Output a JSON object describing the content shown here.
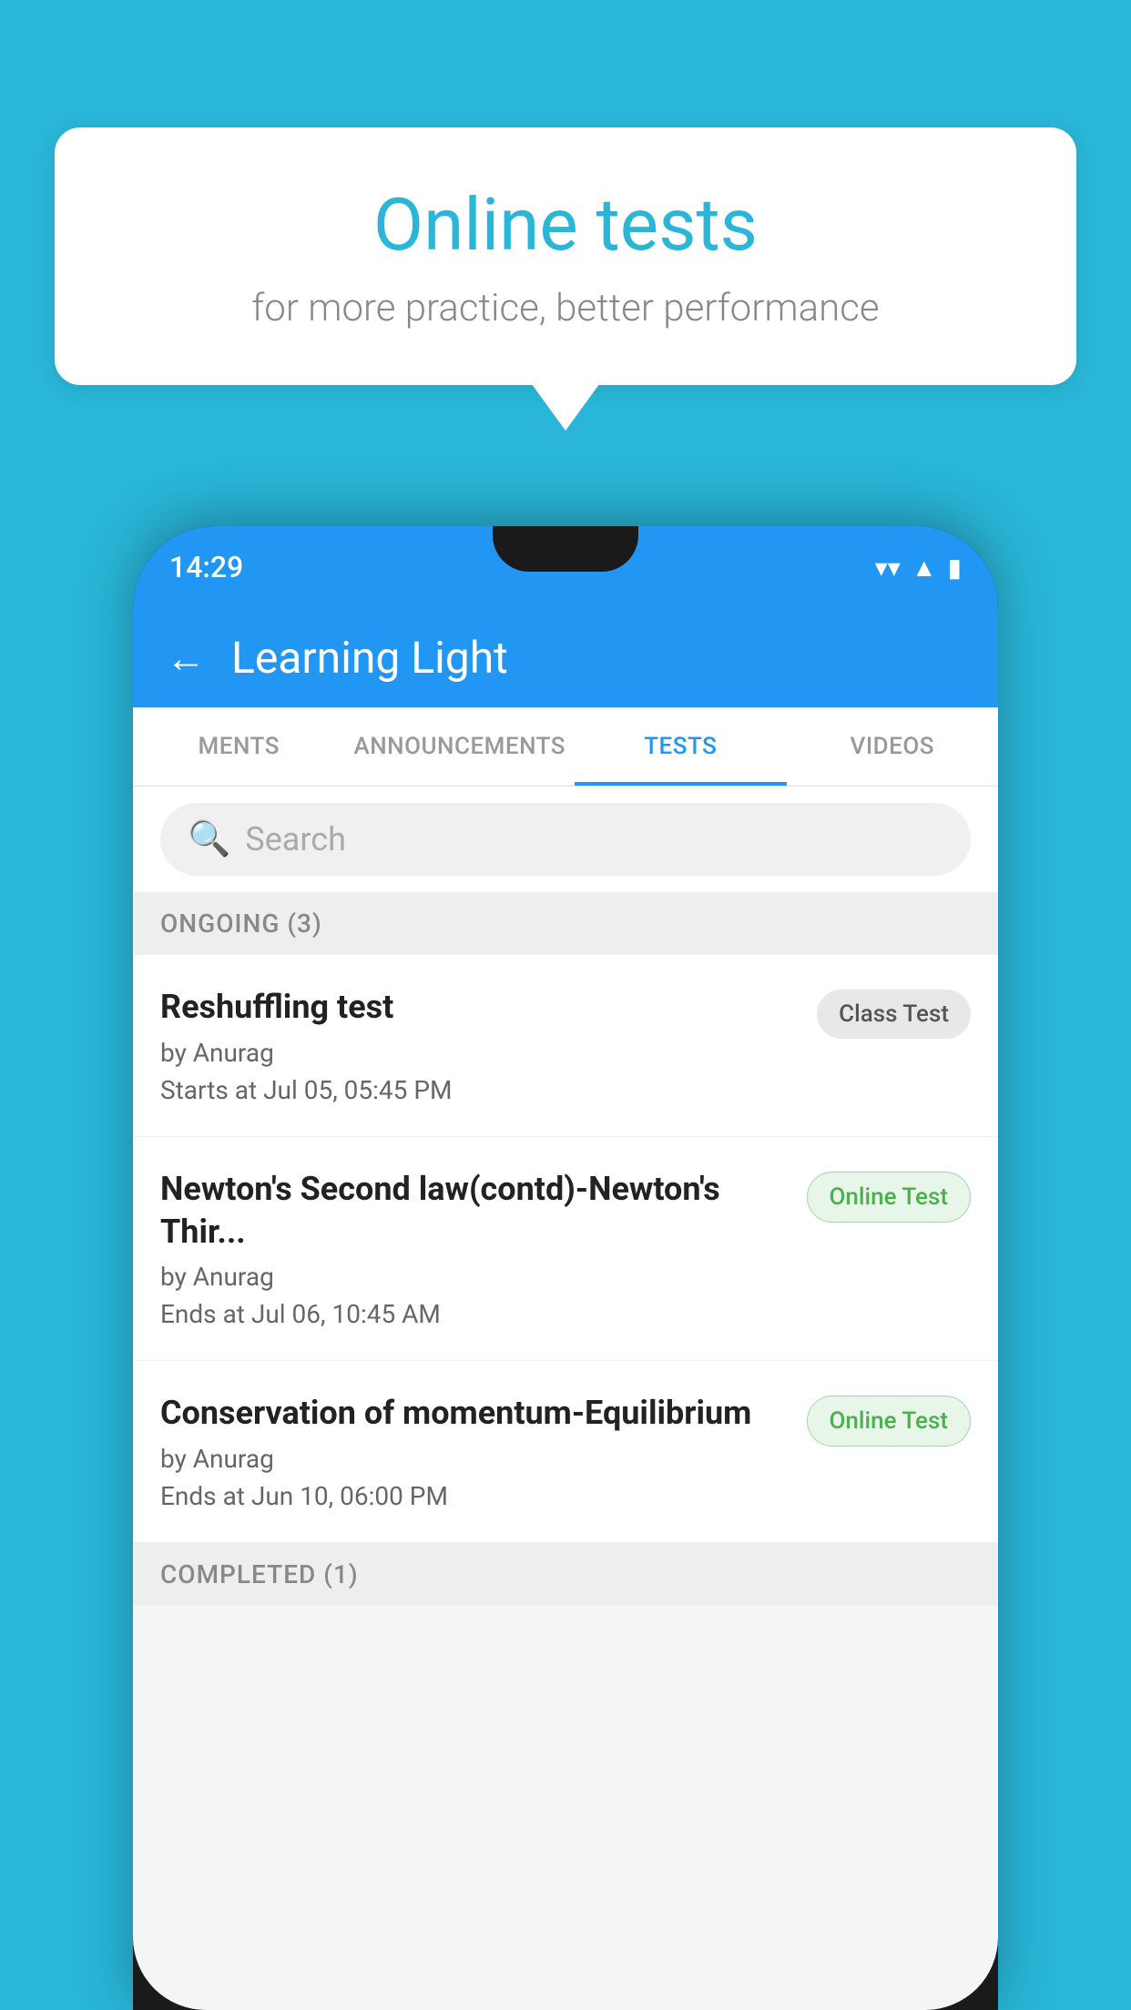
{
  "background": {
    "color": "#29b6d8"
  },
  "speech_bubble": {
    "title": "Online tests",
    "subtitle": "for more practice, better performance"
  },
  "phone": {
    "status_bar": {
      "time": "14:29",
      "wifi_icon": "▼",
      "signal_icon": "▲",
      "battery_icon": "▮"
    },
    "app_header": {
      "back_label": "←",
      "title": "Learning Light"
    },
    "tabs": [
      {
        "label": "MENTS",
        "active": false
      },
      {
        "label": "ANNOUNCEMENTS",
        "active": false
      },
      {
        "label": "TESTS",
        "active": true
      },
      {
        "label": "VIDEOS",
        "active": false
      }
    ],
    "search": {
      "placeholder": "Search"
    },
    "sections": [
      {
        "label": "ONGOING (3)",
        "items": [
          {
            "name": "Reshuffling test",
            "author": "by Anurag",
            "time": "Starts at  Jul 05, 05:45 PM",
            "badge": "Class Test",
            "badge_type": "class"
          },
          {
            "name": "Newton's Second law(contd)-Newton's Thir...",
            "author": "by Anurag",
            "time": "Ends at  Jul 06, 10:45 AM",
            "badge": "Online Test",
            "badge_type": "online"
          },
          {
            "name": "Conservation of momentum-Equilibrium",
            "author": "by Anurag",
            "time": "Ends at  Jun 10, 06:00 PM",
            "badge": "Online Test",
            "badge_type": "online"
          }
        ]
      },
      {
        "label": "COMPLETED (1)",
        "items": []
      }
    ]
  }
}
